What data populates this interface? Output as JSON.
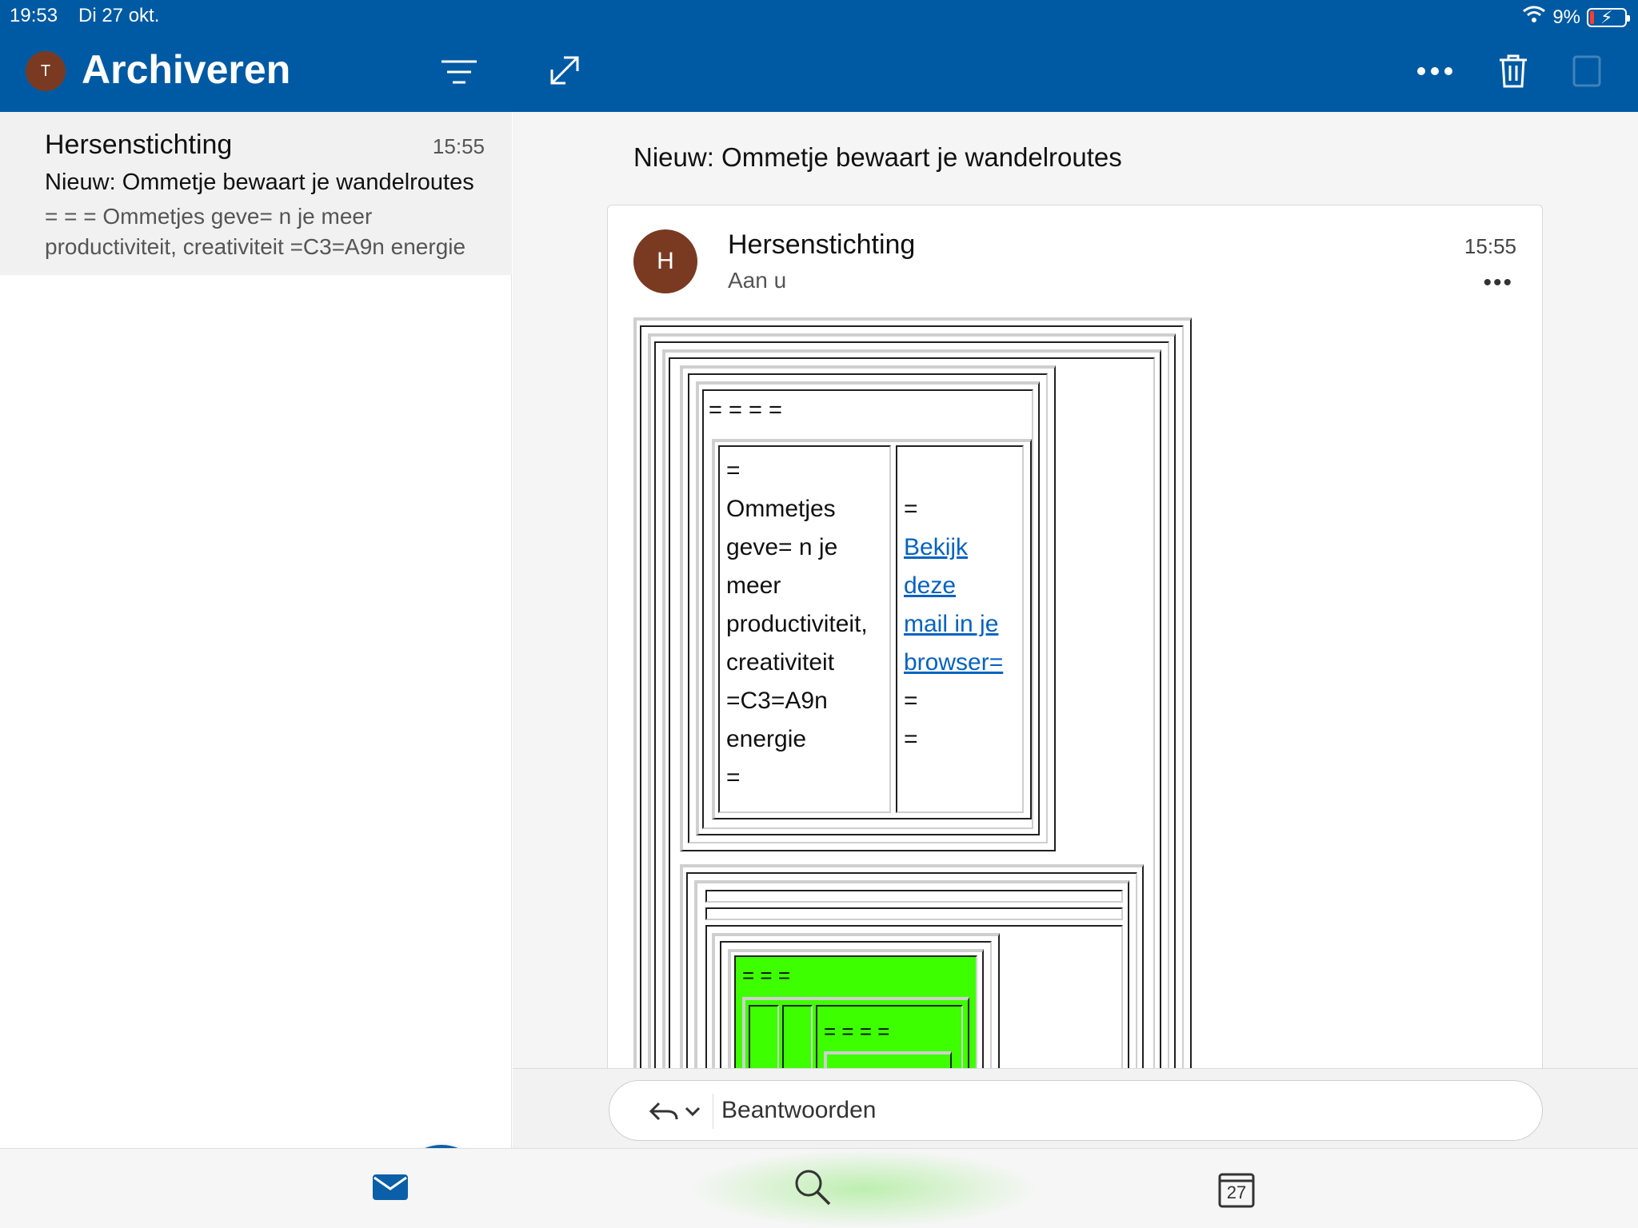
{
  "status": {
    "time": "19:53",
    "date": "Di 27 okt.",
    "battery": "9%"
  },
  "header": {
    "avatar_initial": "T",
    "folder_title": "Archiveren"
  },
  "message_list": [
    {
      "sender": "Hersenstichting",
      "time": "15:55",
      "subject": "Nieuw: Ommetje bewaart je wandelroutes",
      "preview": "= = = Ommetjes geve= n je meer productiviteit, creativiteit =C3=A9n energie"
    }
  ],
  "reading": {
    "subject": "Nieuw: Ommetje bewaart je wandelroutes",
    "sender": "Hersenstichting",
    "avatar_initial": "H",
    "recipient": "Aan u",
    "time": "15:55",
    "more": "•••"
  },
  "body": {
    "top_eq": "= = = =",
    "left_lines": [
      "=",
      "Ommetjes",
      "geve= n je",
      "meer",
      "productiviteit,",
      "creativiteit",
      "=C3=A9n",
      "energie",
      "="
    ],
    "right_eq_top": "=",
    "link_lines": [
      "Bekijk",
      "deze",
      "mail in je",
      "browser="
    ],
    "right_eq_bottom": [
      "=",
      "="
    ],
    "green_eq_1": "= = =",
    "green_eq_2": "= = = ="
  },
  "reply": {
    "label": "Beantwoorden"
  },
  "tabs": {
    "calendar_day": "27"
  },
  "colors": {
    "brand": "#005aa3",
    "link": "#0563c1",
    "banner_green": "#3eff00"
  }
}
